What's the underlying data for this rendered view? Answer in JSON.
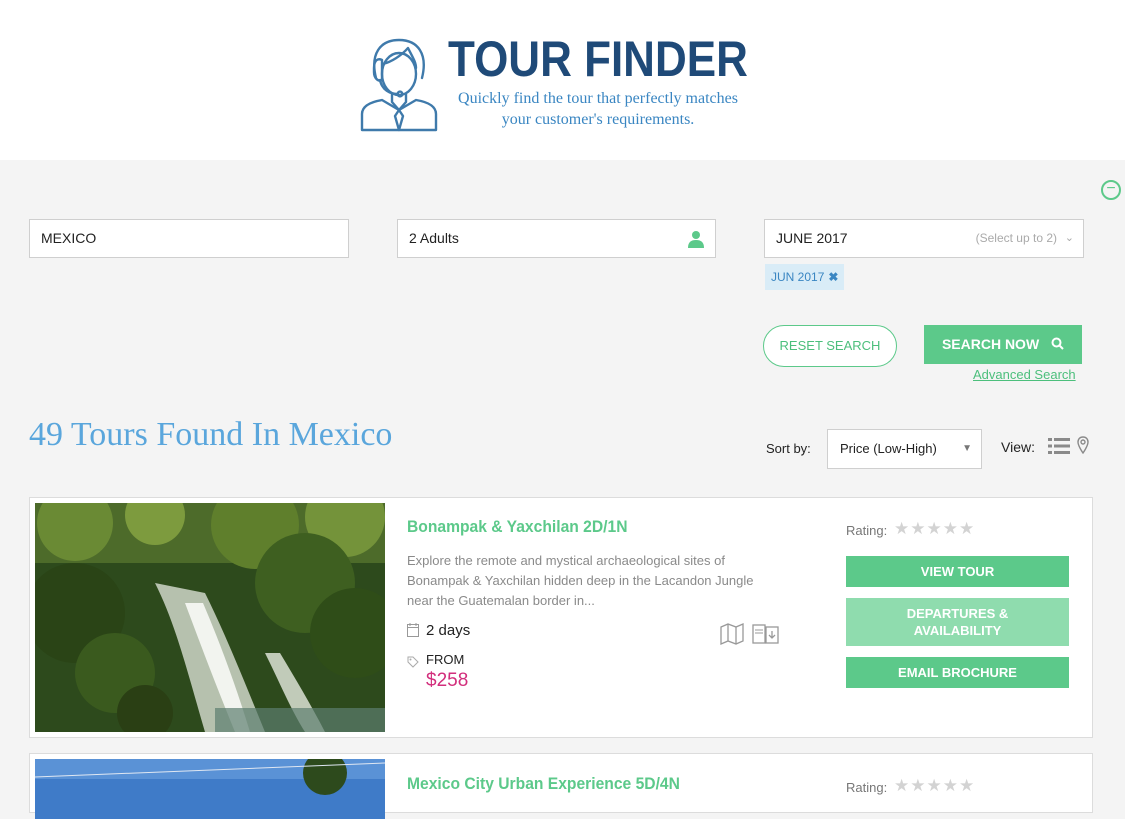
{
  "header": {
    "title": "TOUR FINDER",
    "subtitle": "Quickly find the tour that perfectly matches your customer's requirements.",
    "logo_icon": "agent-headset-icon"
  },
  "search": {
    "destination_value": "MEXICO",
    "travellers_value": "2 Adults",
    "date_value": "JUNE 2017",
    "date_hint": "(Select up to 2)",
    "selected_tag": "JUN 2017",
    "reset_label": "RESET SEARCH",
    "search_label": "SEARCH NOW",
    "advanced_label": "Advanced Search"
  },
  "results": {
    "heading": "49 Tours Found In Mexico",
    "sort_label": "Sort by:",
    "sort_value": "Price (Low-High)",
    "view_label": "View:"
  },
  "tours": [
    {
      "name": "Bonampak & Yaxchilan 2D/1N",
      "description": "Explore the remote and mystical archaeological sites of Bonampak & Yaxchilan hidden deep in the Lacandon Jungle near the Guatemalan border in...",
      "duration": "2 days",
      "from_label": "FROM",
      "price": "$258",
      "rating_label": "Rating:",
      "rating": 0,
      "view_label": "VIEW TOUR",
      "departures_label": "DEPARTURES & AVAILABILITY",
      "email_label": "EMAIL BROCHURE"
    },
    {
      "name": "Mexico City Urban Experience 5D/4N",
      "rating_label": "Rating:",
      "rating": 0
    }
  ],
  "colors": {
    "brand_dark": "#1f4a78",
    "brand_blue": "#3a86c2",
    "accent_green": "#5cc98a",
    "price_pink": "#d22e7c"
  }
}
